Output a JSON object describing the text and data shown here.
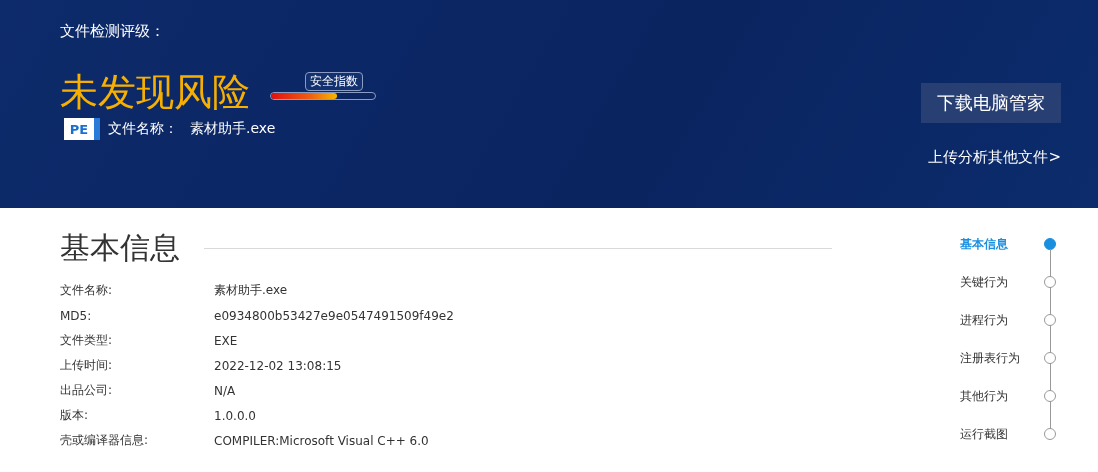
{
  "header": {
    "rating_label": "文件检测评级：",
    "verdict": "未发现风险",
    "safety_index": {
      "label": "安全指数",
      "level": 0.63
    },
    "file_badge": "PE",
    "file_name_label": "文件名称：",
    "file_name": "素材助手.exe",
    "download_button": "下载电脑管家",
    "upload_link": "上传分析其他文件>"
  },
  "basic_info": {
    "title": "基本信息",
    "rows": [
      {
        "label": "文件名称:",
        "value": "素材助手.exe"
      },
      {
        "label": "MD5:",
        "value": "e0934800b53427e9e0547491509f49e2"
      },
      {
        "label": "文件类型:",
        "value": "EXE"
      },
      {
        "label": "上传时间:",
        "value": "2022-12-02 13:08:15"
      },
      {
        "label": "出品公司:",
        "value": "N/A"
      },
      {
        "label": "版本:",
        "value": "1.0.0.0"
      },
      {
        "label": "壳或编译器信息:",
        "value": "COMPILER:Microsoft Visual C++ 6.0"
      }
    ]
  },
  "section_nav": [
    {
      "label": "基本信息",
      "selected": true
    },
    {
      "label": "关键行为",
      "selected": false
    },
    {
      "label": "进程行为",
      "selected": false
    },
    {
      "label": "注册表行为",
      "selected": false
    },
    {
      "label": "其他行为",
      "selected": false
    },
    {
      "label": "运行截图",
      "selected": false
    }
  ]
}
